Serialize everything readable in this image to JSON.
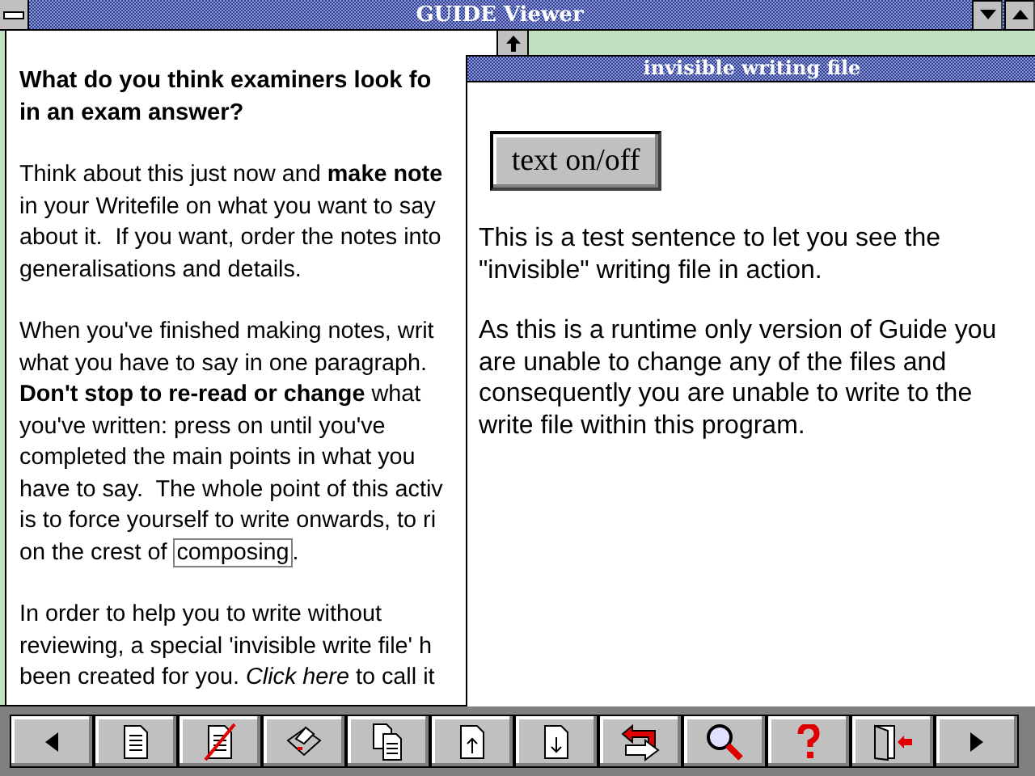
{
  "window": {
    "title": "GUIDE Viewer"
  },
  "document": {
    "paragraphs": [
      {
        "kind": "heading",
        "lines": [
          {
            "text": "What do you think examiners look fo"
          },
          {
            "text": "in an exam answer?"
          }
        ]
      },
      {
        "kind": "body",
        "lines": [
          {
            "text": "Think about this just now and **make note**"
          },
          {
            "text": "in your Writefile on what you want to say"
          },
          {
            "text": "about it.  If you want, order the notes into"
          },
          {
            "text": "generalisations and details."
          }
        ]
      },
      {
        "kind": "body",
        "lines": [
          {
            "text": "When you've finished making notes, writ"
          },
          {
            "text": "what you have to say in one paragraph."
          },
          {
            "text": "**Don't stop to re-read or change** what"
          },
          {
            "text": "you've written: press on until you've"
          },
          {
            "text": "completed the main points in what you"
          },
          {
            "text": "have to say.  The whole point of this activ"
          },
          {
            "text": "is to force yourself to write onwards, to ri"
          },
          {
            "text": "on the crest of ",
            "link": "composing",
            "after": "."
          }
        ]
      },
      {
        "kind": "body",
        "lines": [
          {
            "text": "In order to help you to write without"
          },
          {
            "text": "reviewing, a special 'invisible write file' h"
          },
          {
            "text": "been created for you. *Click here* to call it"
          }
        ]
      }
    ]
  },
  "popup": {
    "title": "invisible writing file",
    "button": "text on/off",
    "paragraphs": [
      "This is a test sentence to let you see the \"invisible\" writing file in action.",
      "As this is a runtime only version of Guide you are unable to change any of the files and consequently you are unable to write to the write file within this program."
    ]
  },
  "toolbar": [
    {
      "kind": "prev"
    },
    {
      "kind": "page"
    },
    {
      "kind": "no-page"
    },
    {
      "kind": "print"
    },
    {
      "kind": "copy"
    },
    {
      "kind": "page-up"
    },
    {
      "kind": "page-down"
    },
    {
      "kind": "back"
    },
    {
      "kind": "search"
    },
    {
      "kind": "help"
    },
    {
      "kind": "exit"
    },
    {
      "kind": "next"
    }
  ]
}
